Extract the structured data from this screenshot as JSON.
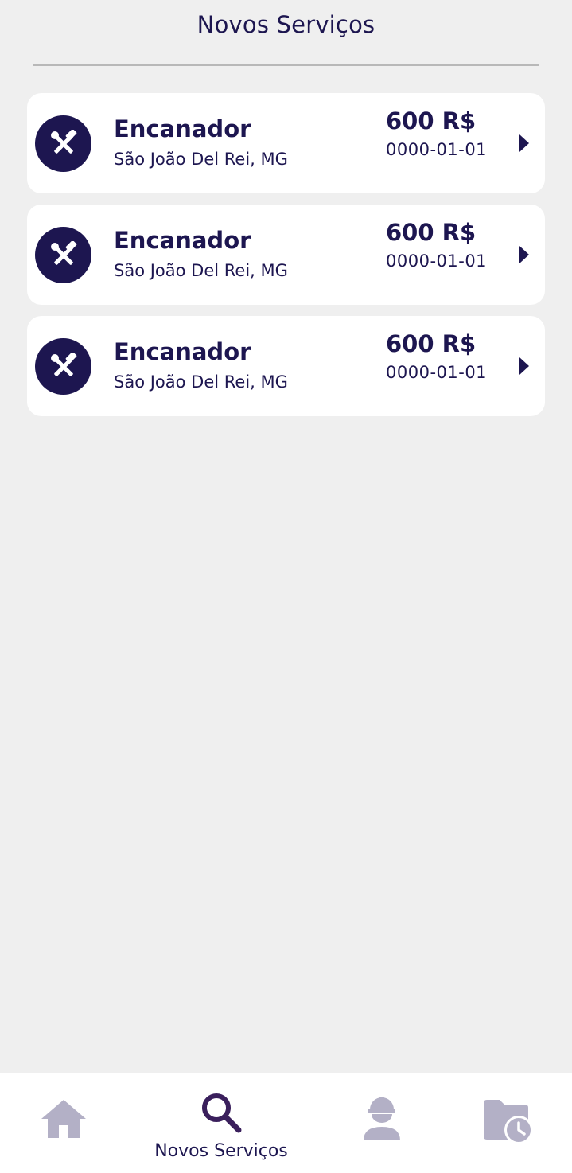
{
  "header": {
    "title": "Novos Serviços"
  },
  "services": [
    {
      "icon": "tools-icon",
      "title": "Encanador",
      "location": "São João Del Rei, MG",
      "price": "600 R$",
      "date": "0000-01-01"
    },
    {
      "icon": "tools-icon",
      "title": "Encanador",
      "location": "São João Del Rei, MG",
      "price": "600 R$",
      "date": "0000-01-01"
    },
    {
      "icon": "tools-icon",
      "title": "Encanador",
      "location": "São João Del Rei, MG",
      "price": "600 R$",
      "date": "0000-01-01"
    }
  ],
  "bottom_nav": {
    "items": [
      {
        "icon": "home-icon",
        "label": "",
        "active": false
      },
      {
        "icon": "search-icon",
        "label": "Novos Serviços",
        "active": true
      },
      {
        "icon": "worker-icon",
        "label": "",
        "active": false
      },
      {
        "icon": "folder-history-icon",
        "label": "",
        "active": false
      }
    ]
  },
  "colors": {
    "primary": "#1d1650",
    "active_icon": "#3a1f5c",
    "inactive_icon": "#b3b0c6",
    "background": "#efefef",
    "card": "#ffffff"
  }
}
